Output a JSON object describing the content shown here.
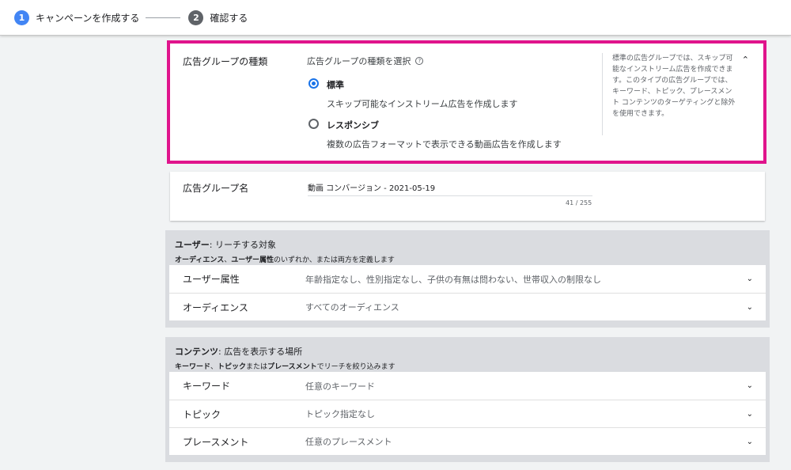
{
  "stepper": {
    "steps": [
      {
        "num": "1",
        "label": "キャンペーンを作成する"
      },
      {
        "num": "2",
        "label": "確認する"
      }
    ]
  },
  "ad_group_type": {
    "label": "広告グループの種類",
    "select_title": "広告グループの種類を選択",
    "options": [
      {
        "title": "標準",
        "desc": "スキップ可能なインストリーム広告を作成します",
        "selected": true
      },
      {
        "title": "レスポンシブ",
        "desc": "複数の広告フォーマットで表示できる動画広告を作成します",
        "selected": false
      }
    ],
    "help_text": "標準の広告グループでは、スキップ可能なインストリーム広告を作成できます。このタイプの広告グループでは、キーワード、トピック、プレースメント コンテンツのターゲティングと除外を使用できます。",
    "highlight_color": "#e0148c"
  },
  "ad_group_name": {
    "label": "広告グループ名",
    "value": "動画 コンバージョン - 2021-05-19",
    "counter": "41 / 255"
  },
  "users_section": {
    "title_bold": "ユーザー",
    "title_rest": ": リーチする対象",
    "sub_bold_1": "オーディエンス",
    "sub_text_1": "、",
    "sub_bold_2": "ユーザー属性",
    "sub_text_2": "のいずれか、または両方を定義します",
    "rows": [
      {
        "label": "ユーザー属性",
        "value": "年齢指定なし、性別指定なし、子供の有無は問わない、世帯収入の制限なし"
      },
      {
        "label": "オーディエンス",
        "value": "すべてのオーディエンス"
      }
    ]
  },
  "content_section": {
    "title_bold": "コンテンツ",
    "title_rest": ": 広告を表示する場所",
    "sub_bold_1": "キーワード",
    "sub_text_1": "、",
    "sub_bold_2": "トピック",
    "sub_text_2": "または",
    "sub_bold_3": "プレースメント",
    "sub_text_3": "でリーチを絞り込みます",
    "rows": [
      {
        "label": "キーワード",
        "value": "任意のキーワード"
      },
      {
        "label": "トピック",
        "value": "トピック指定なし"
      },
      {
        "label": "プレースメント",
        "value": "任意のプレースメント"
      }
    ]
  },
  "icons": {
    "chevron": "chevron-down-icon",
    "collapse": "chevron-up-icon",
    "help": "help-circle-icon"
  }
}
